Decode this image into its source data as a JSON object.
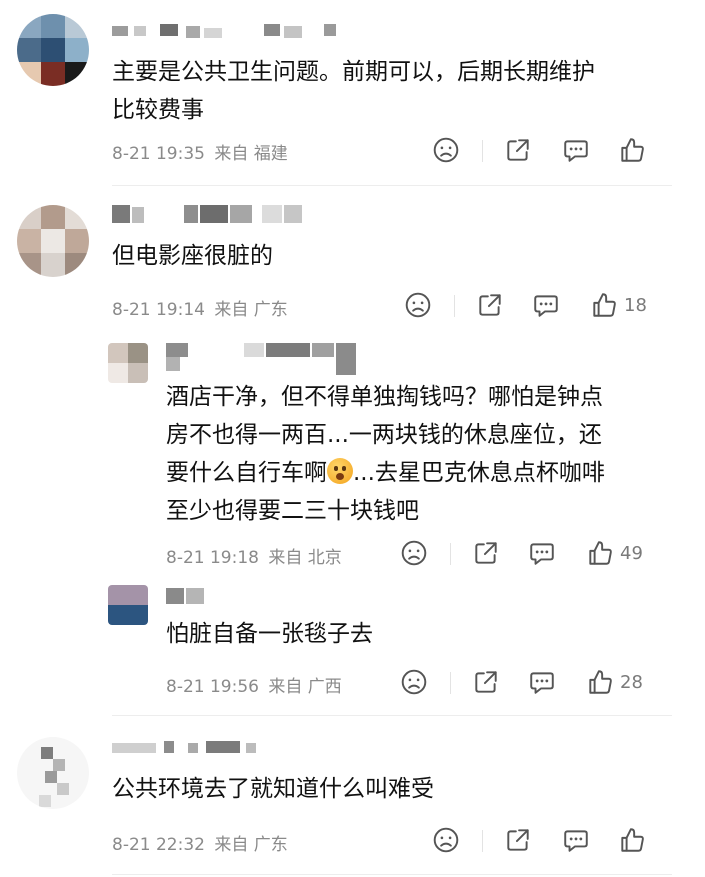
{
  "comments": [
    {
      "text_line1": "主要是公共卫生问题。前期可以，后期长期维护",
      "text_line2": "比较费事",
      "date": "8-21 19:35",
      "source": "来自 福建",
      "likes": ""
    },
    {
      "text_line1": "但电影座很脏的",
      "date": "8-21 19:14",
      "source": "来自 广东",
      "likes": "18"
    },
    {
      "text_line1": "酒店干净，但不得单独掏钱吗？哪怕是钟点",
      "text_line2": "房不也得一两百...一两块钱的休息座位，还",
      "text_line3a": "要什么自行车啊",
      "text_line3b": "...去星巴克休息点杯咖啡",
      "text_line4": "至少也得要二三十块钱吧",
      "date": "8-21 19:18",
      "source": "来自 北京",
      "likes": "49"
    },
    {
      "text_line1": "怕脏自备一张毯子去",
      "date": "8-21 19:56",
      "source": "来自 广西",
      "likes": "28"
    },
    {
      "text_line1": "公共环境去了就知道什么叫难受",
      "date": "8-21 22:32",
      "source": "来自 广东",
      "likes": ""
    }
  ],
  "icons": {
    "dislike": "frown-face-icon",
    "share": "share-icon",
    "reply": "comment-bubble-icon",
    "like": "thumbs-up-icon"
  },
  "colors": {
    "text": "#111111",
    "meta": "#8a8a8a",
    "icon": "#555555",
    "divider": "#ededed"
  }
}
